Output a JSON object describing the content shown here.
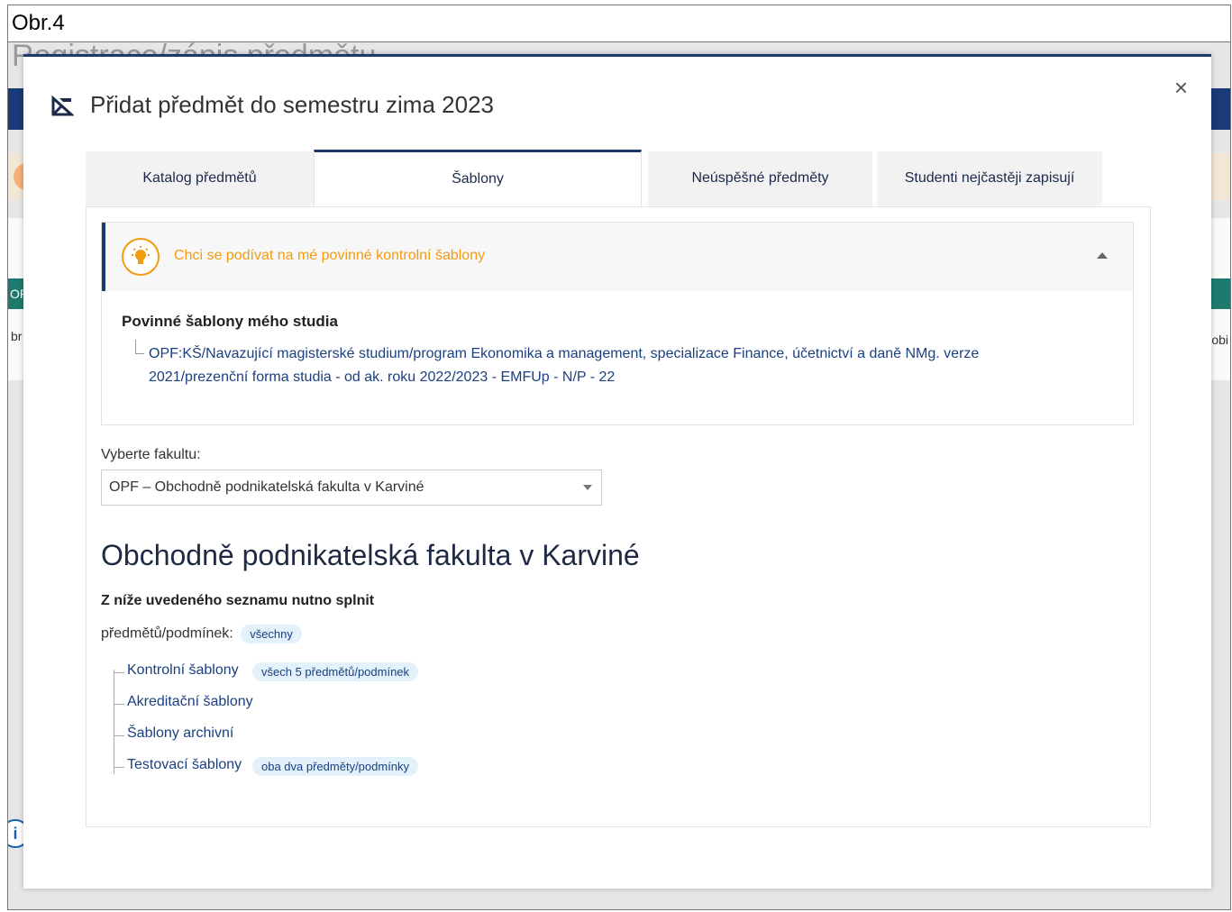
{
  "figure_caption": "Obr.4",
  "background": {
    "heading": "Registrace/zápis předmětu",
    "green_band_text": "OP",
    "left_text": "br",
    "right_text": "obi"
  },
  "modal": {
    "title": "Přidat předmět do semestru zima 2023",
    "close_label": "×",
    "tabs": [
      {
        "label": "Katalog předmětů",
        "active": false
      },
      {
        "label": "Šablony",
        "active": true
      },
      {
        "label": "Neúspěšné předměty",
        "active": false
      },
      {
        "label": "Studenti nejčastěji zapisují",
        "active": false
      }
    ],
    "tip": {
      "text": "Chci se podívat na mé povinné kontrolní šablony",
      "body_title": "Povinné šablony mého studia",
      "body_link": "OPF:KŠ/Navazující magisterské studium/program Ekonomika a management, specializace Finance, účetnictví a daně NMg. verze 2021/prezenční forma studia - od ak. roku 2022/2023 - EMFUp - N/P - 22"
    },
    "faculty": {
      "label": "Vyberte fakultu:",
      "selected": "OPF – Obchodně podnikatelská fakulta v Karviné"
    },
    "section": {
      "heading": "Obchodně podnikatelská fakulta v Karviné",
      "requirement_title": "Z níže uvedeného seznamu nutno splnit",
      "requirement_sub": "předmětů/podmínek:",
      "requirement_badge": "všechny",
      "items": [
        {
          "label": "Kontrolní šablony",
          "badge": "všech 5 předmětů/podmínek"
        },
        {
          "label": "Akreditační šablony",
          "badge": ""
        },
        {
          "label": "Šablony archivní",
          "badge": ""
        },
        {
          "label": "Testovací šablony",
          "badge": "oba dva předměty/podmínky"
        }
      ]
    }
  },
  "colors": {
    "navy": "#1b3a6b",
    "tip_orange": "#f39c12",
    "link_blue": "#1a4080",
    "badge_bg": "#e3f1fb"
  }
}
